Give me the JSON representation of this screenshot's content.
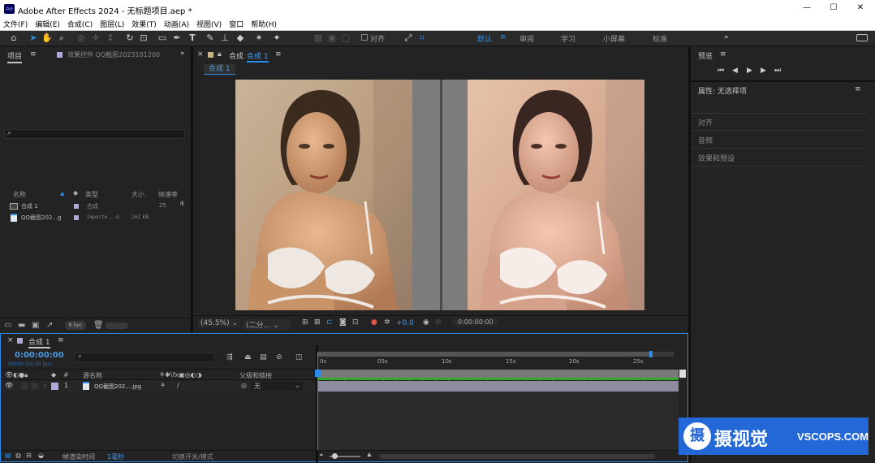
{
  "app": {
    "icon_text": "Ae",
    "title": "Adobe After Effects 2024 - 无标题项目.aep *"
  },
  "window_controls": {
    "minimize": "—",
    "maximize": "☐",
    "close": "✕"
  },
  "menu": [
    "文件(F)",
    "编辑(E)",
    "合成(C)",
    "图层(L)",
    "效果(T)",
    "动画(A)",
    "视图(V)",
    "窗口",
    "帮助(H)"
  ],
  "toolbar": {
    "align_label": "对齐"
  },
  "workspaces": [
    "默认",
    "审阅",
    "学习",
    "小屏幕",
    "标准"
  ],
  "project": {
    "tab_label": "项目",
    "effects_tab": "效果控件 QQ截图2023101200",
    "columns": {
      "name": "名称",
      "type": "类型",
      "size": "大小",
      "fps": "帧速率"
    },
    "items": [
      {
        "name": "合成 1",
        "type": "合成",
        "size": "",
        "fps": "25"
      },
      {
        "name": "QQ截图202...g",
        "type": "Importe...G",
        "size": "161 KB",
        "fps": ""
      }
    ],
    "bpc": "8 bpc"
  },
  "composition": {
    "tab_label": "合成",
    "tab_name": "合成 1",
    "sub_tab": "合成 1",
    "zoom": "(45.5%)",
    "resolution": "(二分...",
    "exposure": "+0.0",
    "timecode": "0:00:00:00"
  },
  "right_panel": {
    "preview_title": "预览",
    "properties_title": "属性: 无选择项",
    "sections": [
      "对齐",
      "音频",
      "效果和预设"
    ]
  },
  "timeline": {
    "tab_name": "合成 1",
    "timecode": "0:00:00:00",
    "frame_info": "00000 (25.00 fps)",
    "columns": {
      "num": "#",
      "source": "源名称",
      "parent": "父级和链接"
    },
    "layer": {
      "index": "1",
      "name": "QQ截图202....jpg",
      "parent": "无"
    },
    "ruler": [
      "0s",
      "05s",
      "10s",
      "15s",
      "20s",
      "25s"
    ],
    "footer": {
      "render_label": "帧渲染时间",
      "render_value": "1毫秒",
      "mode_label": "切换开关/模式"
    }
  },
  "watermark": {
    "text": "摄视觉",
    "url": "VSCOPS.COM"
  },
  "colors": {
    "accent": "#2d8ceb",
    "panel": "#232323",
    "bg": "#1d1d1d",
    "label_purple": "#b3a7d9"
  }
}
